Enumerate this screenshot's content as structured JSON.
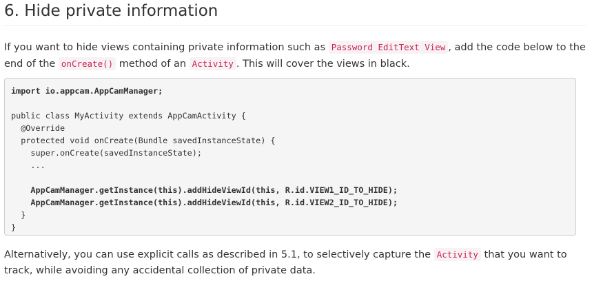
{
  "section": {
    "heading": "6. Hide private information"
  },
  "intro": {
    "t1": "If you want to hide views containing private information such as ",
    "c1": "Password EditText View",
    "t2": ", add the code below to the end of the ",
    "c2": "onCreate()",
    "t3": " method of an ",
    "c3": "Activity",
    "t4": ". This will cover the views in black."
  },
  "code": {
    "lines": [
      "import io.appcam.AppCamManager;",
      "",
      "public class MyActivity extends AppCamActivity {",
      "  @Override",
      "  protected void onCreate(Bundle savedInstanceState) {",
      "    super.onCreate(savedInstanceState);",
      "    ...",
      "",
      "    AppCamManager.getInstance(this).addHideViewId(this, R.id.VIEW1_ID_TO_HIDE);",
      "    AppCamManager.getInstance(this).addHideViewId(this, R.id.VIEW2_ID_TO_HIDE);",
      "  }",
      "}"
    ]
  },
  "outro": {
    "t1": "Alternatively, you can use explicit calls as described in 5.1, to selectively capture the ",
    "c1": "Activity",
    "t2": " that you want to track, while avoiding any accidental collection of private data."
  },
  "colors": {
    "inline_code_text": "#c7254e",
    "inline_code_bg": "#f9f2f4",
    "code_block_bg": "#f5f5f5",
    "code_block_border": "#cccccc"
  }
}
